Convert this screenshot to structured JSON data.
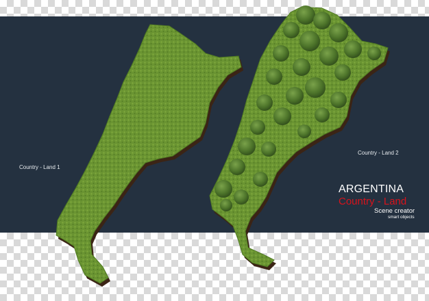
{
  "labels": {
    "land1": "Country - Land 1",
    "land2": "Country - Land 2"
  },
  "branding": {
    "title": "ARGENTINA",
    "subtitle": "Country - Land",
    "creator": "Scene creator",
    "tagline": "smart objects"
  },
  "colors": {
    "band": "#243140",
    "grass": "#5f8a2c",
    "soil": "#4a2f1c",
    "accent_red": "#d8131b"
  }
}
